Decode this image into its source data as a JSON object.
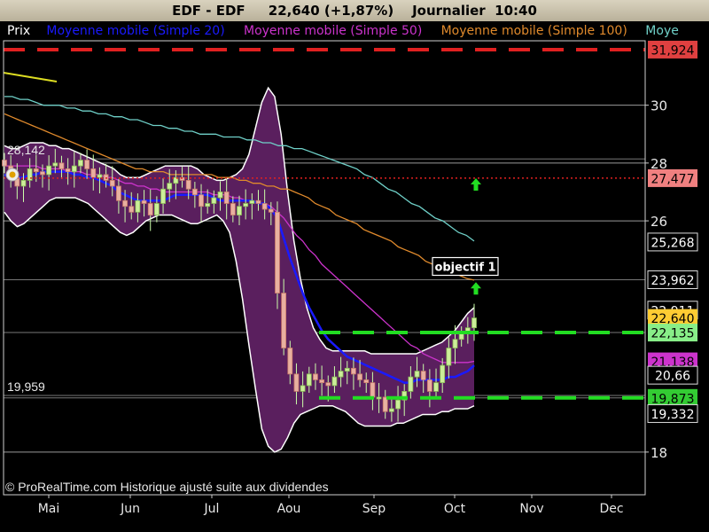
{
  "window": {
    "title": "EDF - EDF     22,640 (+1,87%)    Journalier  10:40"
  },
  "legend": {
    "items": [
      {
        "label": "Prix",
        "color": "#ffffff"
      },
      {
        "label": "Moyenne mobile (Simple 20)",
        "color": "#1a1aff"
      },
      {
        "label": "Moyenne mobile (Simple 50)",
        "color": "#cc33cc"
      },
      {
        "label": "Moyenne mobile (Simple 100)",
        "color": "#e08a2c"
      },
      {
        "label": "Moye",
        "color": "#6fd0c8"
      }
    ]
  },
  "footer": {
    "copyright": "© ProRealTime.com Historique ajusté suite aux dividendes"
  },
  "chart_data": {
    "type": "candlestick",
    "y_axis": {
      "ticks": [
        18,
        26,
        28,
        30
      ],
      "tick_labels": [
        "18",
        "26",
        "28",
        "30"
      ],
      "range": [
        17.0,
        32.3
      ]
    },
    "x_axis": {
      "labels": [
        "Mai",
        "Jun",
        "Jul",
        "Aou",
        "Sep",
        "Oct",
        "Nov",
        "Dec"
      ]
    },
    "price_tags": [
      {
        "value": 31.924,
        "label": "31,924",
        "bg": "#e04040",
        "fg": "#000000"
      },
      {
        "value": 27.477,
        "label": "27,477",
        "bg": "#f08080",
        "fg": "#000000"
      },
      {
        "value": 25.268,
        "label": "25,268",
        "bg": "#000000",
        "fg": "#ffffff"
      },
      {
        "value": 23.962,
        "label": "23,962",
        "bg": "#000000",
        "fg": "#ffffff"
      },
      {
        "value": 22.911,
        "label": "22,911",
        "bg": "#000000",
        "fg": "#ffffff"
      },
      {
        "value": 22.64,
        "label": "22,640",
        "bg": "#ffcc33",
        "fg": "#000000"
      },
      {
        "value": 22.135,
        "label": "22,135",
        "bg": "#88ee88",
        "fg": "#000000"
      },
      {
        "value": 21.138,
        "label": "21,138",
        "bg": "#cc33cc",
        "fg": "#000000"
      },
      {
        "value": 20.66,
        "label": "20,66",
        "bg": "#000000",
        "fg": "#ffffff"
      },
      {
        "value": 19.873,
        "label": "19,873",
        "bg": "#33cc33",
        "fg": "#000000"
      },
      {
        "value": 19.332,
        "label": "19,332",
        "bg": "#000000",
        "fg": "#ffffff"
      }
    ],
    "reference_lines": [
      {
        "value": 31.924,
        "color": "#e02020",
        "style": "dashed"
      },
      {
        "value": 27.477,
        "color": "#e02020",
        "style": "dotted"
      },
      {
        "value": 22.135,
        "color": "#22dd22",
        "style": "dashed"
      },
      {
        "value": 19.873,
        "color": "#22dd22",
        "style": "dashed"
      }
    ],
    "level_labels": [
      {
        "value": 28.142,
        "label": "28,142"
      },
      {
        "value": 19.959,
        "label": "19,959"
      }
    ],
    "annotations": [
      {
        "text": "objectif 1",
        "at": 23.962
      }
    ],
    "arrows": [
      {
        "direction": "up",
        "color": "#22dd22",
        "value": 27.2
      },
      {
        "direction": "up",
        "color": "#22dd22",
        "value": 23.6
      }
    ],
    "series": [
      {
        "name": "Prix",
        "values": [
          27.9,
          27.5,
          27.2,
          27.4,
          27.8,
          27.7,
          27.6,
          27.9,
          28.0,
          27.8,
          27.7,
          27.9,
          28.1,
          27.8,
          27.5,
          27.6,
          27.4,
          27.2,
          26.7,
          26.5,
          26.3,
          26.7,
          26.6,
          26.2,
          26.6,
          27.1,
          27.3,
          27.5,
          27.4,
          27.1,
          26.9,
          26.5,
          26.6,
          26.8,
          27.0,
          26.6,
          26.2,
          26.5,
          26.6,
          26.7,
          26.6,
          26.4,
          26.3,
          23.5,
          21.6,
          20.7,
          20.1,
          20.3,
          20.7,
          20.5,
          20.4,
          20.3,
          20.6,
          20.8,
          20.9,
          20.7,
          20.5,
          20.4,
          19.9,
          19.9,
          19.4,
          19.5,
          19.8,
          20.1,
          20.6,
          20.8,
          20.5,
          20.1,
          20.4,
          21.0,
          21.6,
          21.9,
          22.1,
          22.3,
          22.64
        ]
      },
      {
        "name": "Moyenne mobile (Simple 20)",
        "values": [
          27.6,
          27.5,
          27.5,
          27.5,
          27.6,
          27.6,
          27.7,
          27.7,
          27.7,
          27.7,
          27.7,
          27.6,
          27.6,
          27.5,
          27.5,
          27.4,
          27.3,
          27.2,
          27.0,
          26.9,
          26.8,
          26.7,
          26.7,
          26.7,
          26.7,
          26.7,
          26.8,
          26.9,
          26.9,
          26.9,
          26.9,
          26.9,
          26.9,
          26.8,
          26.7,
          26.7,
          26.7,
          26.7,
          26.7,
          26.7,
          26.6,
          26.6,
          26.4,
          26.1,
          25.4,
          24.7,
          24.1,
          23.5,
          23.0,
          22.6,
          22.2,
          21.9,
          21.7,
          21.5,
          21.3,
          21.2,
          21.1,
          21.0,
          20.9,
          20.8,
          20.7,
          20.6,
          20.5,
          20.4,
          20.4,
          20.5,
          20.5,
          20.5,
          20.5,
          20.5,
          20.6,
          20.6,
          20.7,
          20.8,
          21.0
        ]
      },
      {
        "name": "Moyenne mobile (Simple 50)",
        "values": [
          27.9,
          27.9,
          27.9,
          27.9,
          27.9,
          27.9,
          27.8,
          27.8,
          27.8,
          27.8,
          27.7,
          27.7,
          27.7,
          27.6,
          27.6,
          27.6,
          27.5,
          27.5,
          27.4,
          27.3,
          27.3,
          27.2,
          27.2,
          27.1,
          27.1,
          27.0,
          27.0,
          27.0,
          27.0,
          27.0,
          27.0,
          27.0,
          27.0,
          26.9,
          26.9,
          26.9,
          26.8,
          26.8,
          26.7,
          26.7,
          26.6,
          26.6,
          26.5,
          26.3,
          26.1,
          25.8,
          25.5,
          25.3,
          25.0,
          24.8,
          24.5,
          24.3,
          24.1,
          23.9,
          23.7,
          23.5,
          23.3,
          23.1,
          22.9,
          22.7,
          22.5,
          22.3,
          22.1,
          21.9,
          21.7,
          21.6,
          21.4,
          21.3,
          21.2,
          21.1,
          21.1,
          21.1,
          21.1,
          21.1,
          21.14
        ]
      },
      {
        "name": "Moyenne mobile (Simple 100)",
        "values": [
          29.7,
          29.6,
          29.5,
          29.4,
          29.3,
          29.2,
          29.1,
          29.0,
          28.9,
          28.8,
          28.7,
          28.6,
          28.5,
          28.4,
          28.3,
          28.2,
          28.1,
          28.0,
          27.9,
          27.8,
          27.8,
          27.7,
          27.7,
          27.7,
          27.6,
          27.6,
          27.6,
          27.6,
          27.6,
          27.6,
          27.6,
          27.5,
          27.5,
          27.5,
          27.4,
          27.4,
          27.3,
          27.3,
          27.2,
          27.2,
          27.1,
          27.1,
          27.0,
          26.9,
          26.8,
          26.6,
          26.5,
          26.4,
          26.2,
          26.1,
          26.0,
          25.9,
          25.7,
          25.6,
          25.5,
          25.4,
          25.3,
          25.1,
          25.0,
          24.9,
          24.8,
          24.6,
          24.5,
          24.4,
          24.3,
          24.2,
          24.1,
          24.0,
          23.95
        ]
      },
      {
        "name": "Moye",
        "values": [
          30.3,
          30.3,
          30.2,
          30.2,
          30.1,
          30.0,
          30.0,
          30.0,
          29.9,
          29.9,
          29.8,
          29.8,
          29.7,
          29.7,
          29.6,
          29.6,
          29.5,
          29.5,
          29.4,
          29.3,
          29.3,
          29.2,
          29.2,
          29.1,
          29.1,
          29.0,
          29.0,
          29.0,
          28.9,
          28.9,
          28.9,
          28.8,
          28.8,
          28.7,
          28.7,
          28.6,
          28.6,
          28.5,
          28.5,
          28.4,
          28.3,
          28.2,
          28.1,
          28.0,
          27.9,
          27.8,
          27.6,
          27.5,
          27.3,
          27.1,
          27.0,
          26.8,
          26.6,
          26.5,
          26.3,
          26.1,
          26.0,
          25.8,
          25.6,
          25.5,
          25.3
        ]
      },
      {
        "name": "Bollinger haute",
        "values": [
          28.6,
          28.5,
          28.5,
          28.6,
          28.7,
          28.7,
          28.7,
          28.6,
          28.6,
          28.5,
          28.5,
          28.4,
          28.3,
          28.2,
          28.1,
          28.0,
          27.9,
          27.8,
          27.6,
          27.5,
          27.5,
          27.5,
          27.6,
          27.7,
          27.8,
          27.9,
          27.9,
          27.9,
          27.9,
          27.9,
          27.8,
          27.6,
          27.5,
          27.4,
          27.4,
          27.5,
          27.6,
          27.8,
          28.3,
          29.2,
          30.1,
          30.6,
          30.3,
          29.0,
          27.0,
          25.3,
          24.0,
          23.0,
          22.3,
          21.9,
          21.6,
          21.5,
          21.5,
          21.5,
          21.5,
          21.5,
          21.5,
          21.4,
          21.4,
          21.4,
          21.4,
          21.4,
          21.4,
          21.4,
          21.4,
          21.5,
          21.6,
          21.7,
          21.8,
          22.0,
          22.2,
          22.5,
          22.8,
          23.0
        ]
      },
      {
        "name": "Bollinger basse",
        "values": [
          26.3,
          26.0,
          25.8,
          25.9,
          26.1,
          26.3,
          26.5,
          26.7,
          26.8,
          26.8,
          26.8,
          26.8,
          26.7,
          26.6,
          26.4,
          26.2,
          26.0,
          25.8,
          25.6,
          25.5,
          25.6,
          25.8,
          26.0,
          26.1,
          26.2,
          26.2,
          26.2,
          26.1,
          26.0,
          25.9,
          25.9,
          26.0,
          26.1,
          26.2,
          26.0,
          25.6,
          24.6,
          23.3,
          21.7,
          20.2,
          18.8,
          18.2,
          18.0,
          18.1,
          18.5,
          19.0,
          19.3,
          19.4,
          19.5,
          19.6,
          19.6,
          19.6,
          19.5,
          19.4,
          19.2,
          19.0,
          18.9,
          18.9,
          18.9,
          18.9,
          18.9,
          19.0,
          19.0,
          19.1,
          19.2,
          19.3,
          19.3,
          19.3,
          19.4,
          19.4,
          19.5,
          19.5,
          19.5,
          19.6
        ]
      }
    ]
  }
}
